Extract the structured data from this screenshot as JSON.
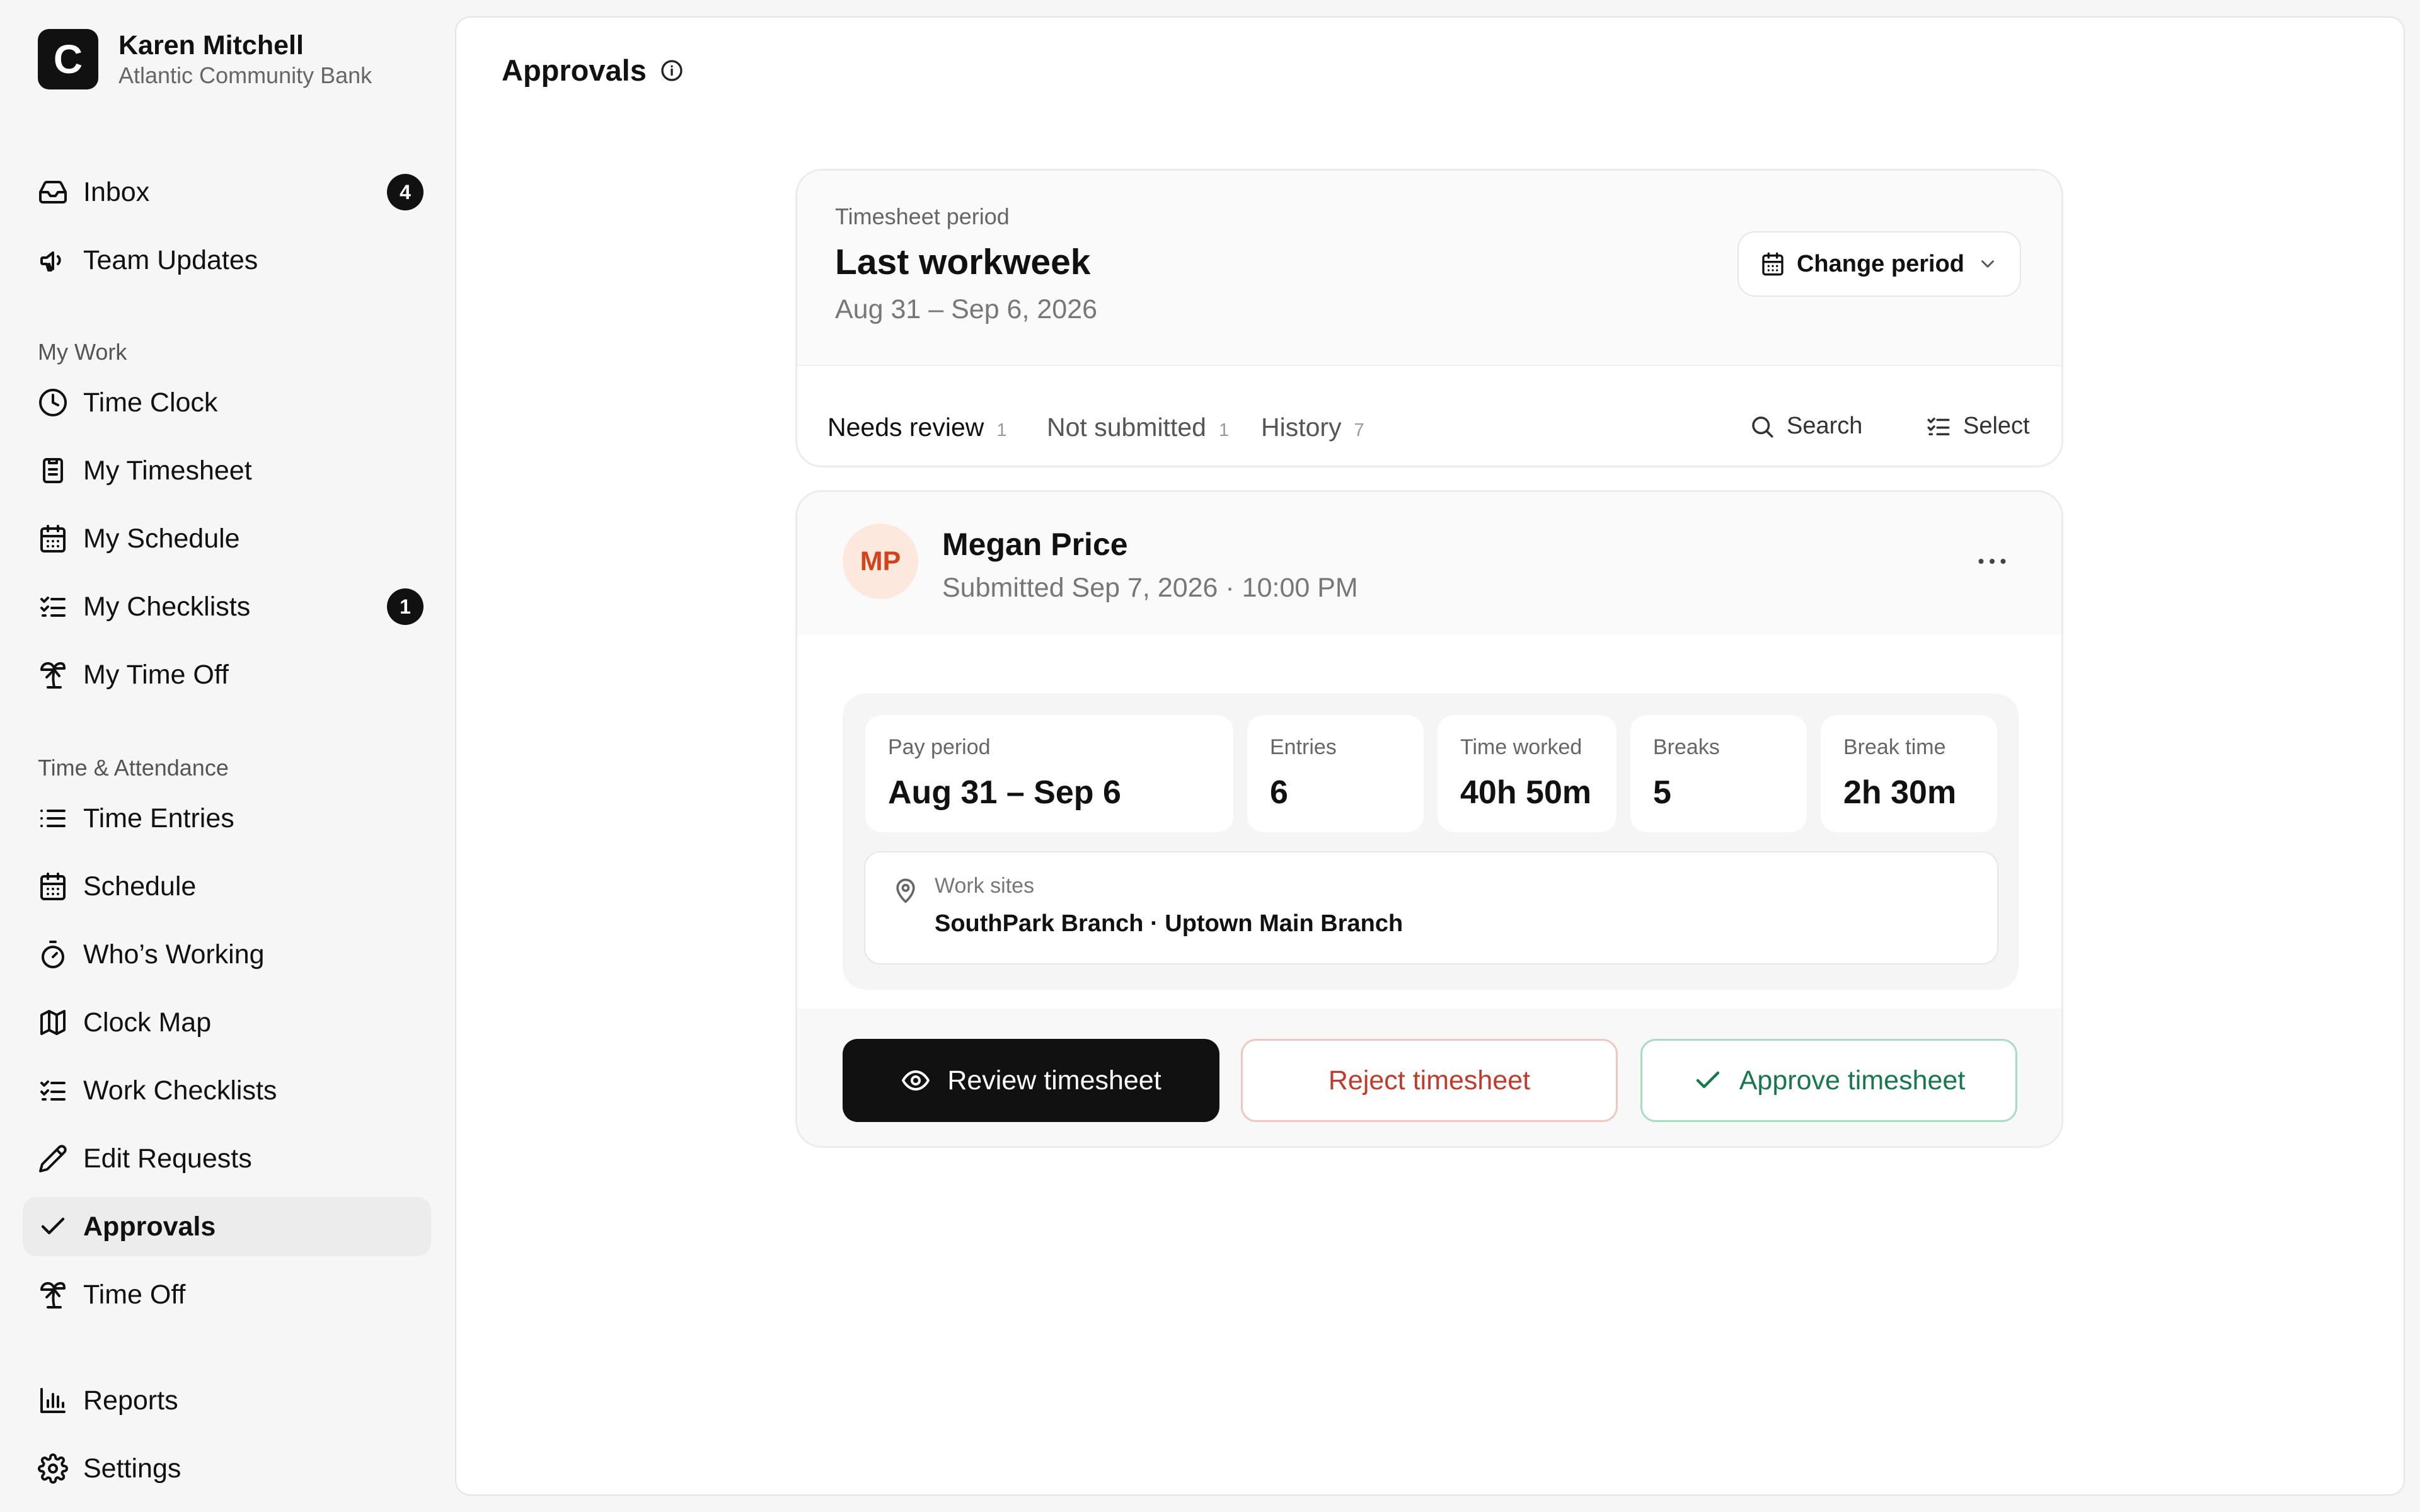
{
  "account": {
    "logo_letter": "C",
    "name": "Karen Mitchell",
    "org": "Atlantic Community Bank"
  },
  "nav": {
    "inbox": {
      "label": "Inbox",
      "badge": "4",
      "icon": "inbox-icon"
    },
    "team_updates": {
      "label": "Team Updates",
      "icon": "megaphone-icon"
    },
    "my_work_heading": "My Work",
    "time_clock": {
      "label": "Time Clock",
      "icon": "clock-icon"
    },
    "my_timesheet": {
      "label": "My Timesheet",
      "icon": "clipboard-icon"
    },
    "my_schedule": {
      "label": "My Schedule",
      "icon": "calendar-icon"
    },
    "my_checklists": {
      "label": "My Checklists",
      "badge": "1",
      "icon": "checklist-icon"
    },
    "my_time_off": {
      "label": "My Time Off",
      "icon": "palm-tree-icon"
    },
    "time_attendance_heading": "Time & Attendance",
    "time_entries": {
      "label": "Time Entries",
      "icon": "list-icon"
    },
    "schedule": {
      "label": "Schedule",
      "icon": "calendar-icon"
    },
    "whos_working": {
      "label": "Who’s Working",
      "icon": "stopwatch-icon"
    },
    "clock_map": {
      "label": "Clock Map",
      "icon": "map-icon"
    },
    "work_checklists": {
      "label": "Work Checklists",
      "icon": "checklist-icon"
    },
    "edit_requests": {
      "label": "Edit Requests",
      "icon": "pencil-icon"
    },
    "approvals": {
      "label": "Approvals",
      "icon": "check-icon"
    },
    "time_off": {
      "label": "Time Off",
      "icon": "palm-tree-icon"
    },
    "reports": {
      "label": "Reports",
      "icon": "bar-chart-icon"
    },
    "settings": {
      "label": "Settings",
      "icon": "gear-icon"
    }
  },
  "page": {
    "title": "Approvals"
  },
  "period": {
    "label": "Timesheet period",
    "name": "Last workweek",
    "range": "Aug 31 – Sep 6, 2026",
    "change_button": "Change period"
  },
  "tabs": [
    {
      "label": "Needs review",
      "count": "1"
    },
    {
      "label": "Not submitted",
      "count": "1"
    },
    {
      "label": "History",
      "count": "7"
    }
  ],
  "tools": {
    "search": "Search",
    "select": "Select"
  },
  "submission": {
    "initials": "MP",
    "name": "Megan Price",
    "submitted": "Submitted Sep 7, 2026 · 10:00 PM",
    "stats": [
      {
        "label": "Pay period",
        "value": "Aug 31 – Sep 6"
      },
      {
        "label": "Entries",
        "value": "6"
      },
      {
        "label": "Time worked",
        "value": "40h 50m"
      },
      {
        "label": "Breaks",
        "value": "5"
      },
      {
        "label": "Break time",
        "value": "2h 30m"
      }
    ],
    "sites_label": "Work sites",
    "sites_value": "SouthPark Branch · Uptown Main Branch",
    "review_button": "Review timesheet",
    "reject_button": "Reject timesheet",
    "approve_button": "Approve timesheet"
  },
  "colors": {
    "accent": "#111111",
    "reject": "#c23a2b",
    "approve": "#17784c",
    "avatar_bg": "#fde8dd",
    "avatar_text": "#d2431b"
  }
}
